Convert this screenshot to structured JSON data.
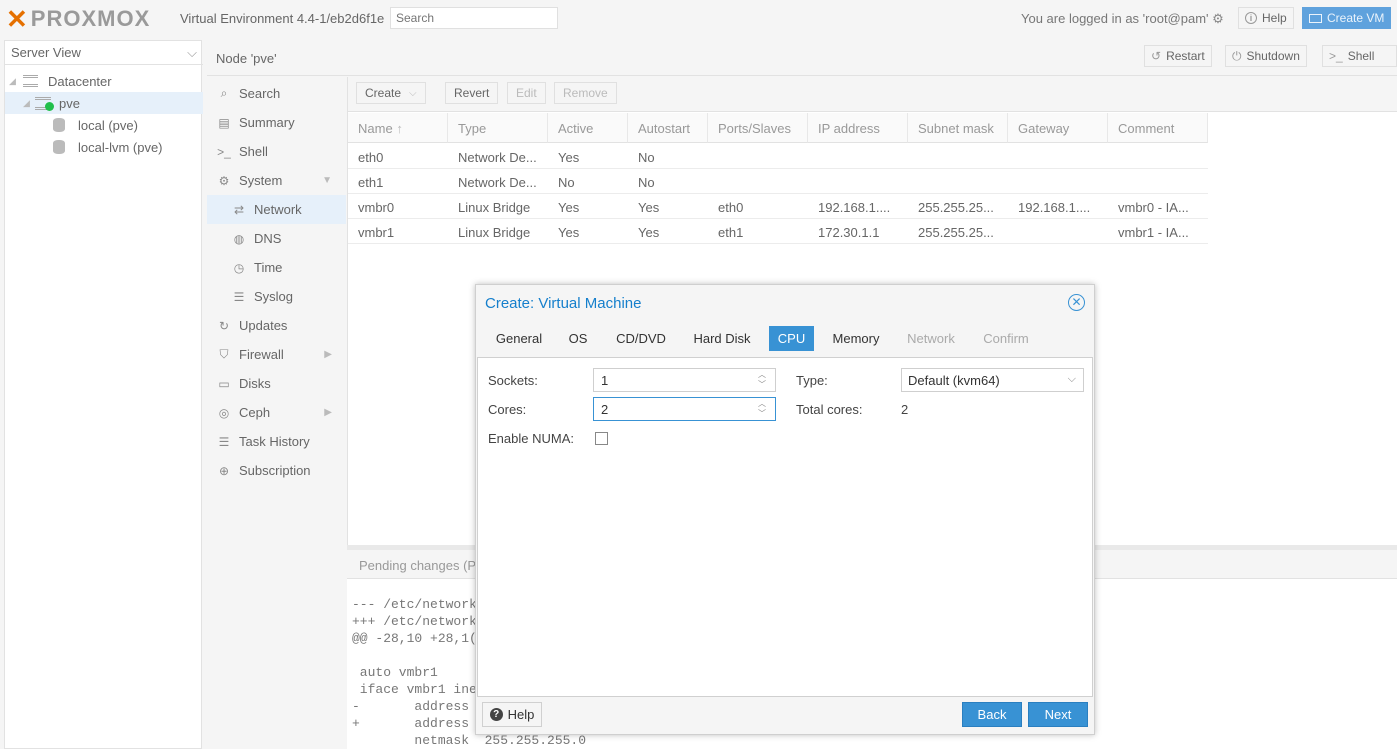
{
  "header": {
    "brand": "PROXMOX",
    "version": "Virtual Environment 4.4-1/eb2d6f1e",
    "search_placeholder": "Search",
    "logged_in": "You are logged in as 'root@pam'",
    "help_label": "Help",
    "create_vm_label": "Create VM"
  },
  "tree": {
    "view_label": "Server View",
    "items": [
      {
        "label": "Datacenter"
      },
      {
        "label": "pve"
      },
      {
        "label": "local (pve)"
      },
      {
        "label": "local-lvm (pve)"
      }
    ]
  },
  "node": {
    "title": "Node 'pve'",
    "restart_label": "Restart",
    "shutdown_label": "Shutdown",
    "shell_label": "Shell"
  },
  "menu": {
    "items": [
      {
        "label": "Search",
        "icon": "search-icon"
      },
      {
        "label": "Summary",
        "icon": "summary-icon"
      },
      {
        "label": "Shell",
        "icon": "terminal-icon"
      },
      {
        "label": "System",
        "icon": "cogs-icon"
      },
      {
        "label": "Network",
        "icon": "exchange-icon"
      },
      {
        "label": "DNS",
        "icon": "globe-icon"
      },
      {
        "label": "Time",
        "icon": "clock-icon"
      },
      {
        "label": "Syslog",
        "icon": "list-icon"
      },
      {
        "label": "Updates",
        "icon": "refresh-icon"
      },
      {
        "label": "Firewall",
        "icon": "shield-icon"
      },
      {
        "label": "Disks",
        "icon": "hdd-icon"
      },
      {
        "label": "Ceph",
        "icon": "ceph-icon"
      },
      {
        "label": "Task History",
        "icon": "list-icon"
      },
      {
        "label": "Subscription",
        "icon": "support-icon"
      }
    ]
  },
  "network": {
    "toolbar": {
      "create": "Create",
      "revert": "Revert",
      "edit": "Edit",
      "remove": "Remove"
    },
    "columns": [
      "Name",
      "Type",
      "Active",
      "Autostart",
      "Ports/Slaves",
      "IP address",
      "Subnet mask",
      "Gateway",
      "Comment"
    ],
    "rows": [
      [
        "eth0",
        "Network De...",
        "Yes",
        "No",
        "",
        "",
        "",
        "",
        ""
      ],
      [
        "eth1",
        "Network De...",
        "No",
        "No",
        "",
        "",
        "",
        "",
        ""
      ],
      [
        "vmbr0",
        "Linux Bridge",
        "Yes",
        "Yes",
        "eth0",
        "192.168.1....",
        "255.255.25...",
        "192.168.1....",
        "vmbr0 - IA..."
      ],
      [
        "vmbr1",
        "Linux Bridge",
        "Yes",
        "Yes",
        "eth1",
        "172.30.1.1",
        "255.255.25...",
        "",
        "vmbr1 - IA..."
      ]
    ],
    "pending_title": "Pending changes (P",
    "diff_lines": [
      "--- /etc/network",
      "+++ /etc/network",
      "@@ -28,10 +28,1(",
      "",
      " auto vmbr1",
      " iface vmbr1 ine",
      "-       address",
      "+       address",
      "        netmask  255.255.255.0"
    ]
  },
  "dialog": {
    "title": "Create: Virtual Machine",
    "tabs": [
      "General",
      "OS",
      "CD/DVD",
      "Hard Disk",
      "CPU",
      "Memory",
      "Network",
      "Confirm"
    ],
    "active_tab": "CPU",
    "sockets_label": "Sockets:",
    "sockets_value": "1",
    "cores_label": "Cores:",
    "cores_value": "2",
    "numa_label": "Enable NUMA:",
    "type_label": "Type:",
    "type_value": "Default (kvm64)",
    "total_cores_label": "Total cores:",
    "total_cores_value": "2",
    "help_label": "Help",
    "back_label": "Back",
    "next_label": "Next"
  }
}
